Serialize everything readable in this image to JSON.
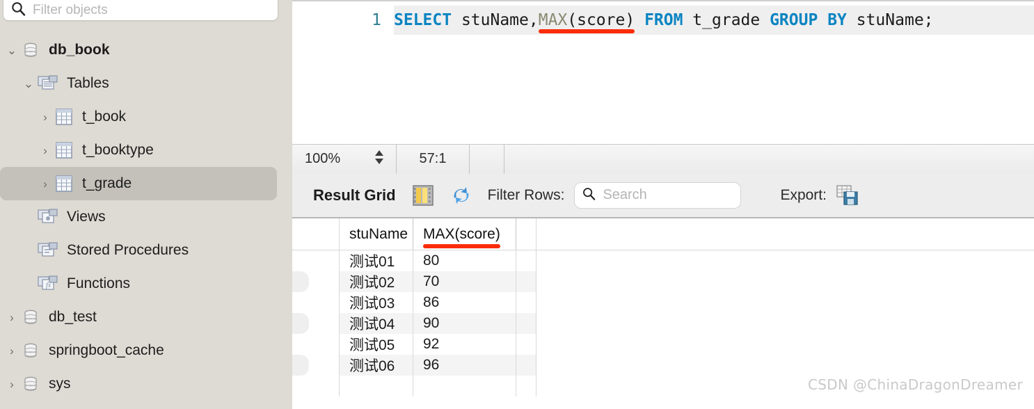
{
  "sidebar": {
    "filter": {
      "placeholder": "Filter objects",
      "value": "",
      "icon": "search-icon"
    },
    "items": [
      {
        "label": "db_book",
        "icon": "database-icon",
        "twisty": "⌄",
        "depth": 0,
        "bold": true,
        "selected": false
      },
      {
        "label": "Tables",
        "icon": "folder-tables-icon",
        "twisty": "⌄",
        "depth": 1,
        "bold": false,
        "selected": false
      },
      {
        "label": "t_book",
        "icon": "table-icon",
        "twisty": "›",
        "depth": 2,
        "bold": false,
        "selected": false
      },
      {
        "label": "t_booktype",
        "icon": "table-icon",
        "twisty": "›",
        "depth": 2,
        "bold": false,
        "selected": false
      },
      {
        "label": "t_grade",
        "icon": "table-icon",
        "twisty": "›",
        "depth": 2,
        "bold": false,
        "selected": true
      },
      {
        "label": "Views",
        "icon": "folder-views-icon",
        "twisty": "",
        "depth": 1,
        "bold": false,
        "selected": false
      },
      {
        "label": "Stored Procedures",
        "icon": "folder-procedures-icon",
        "twisty": "",
        "depth": 1,
        "bold": false,
        "selected": false
      },
      {
        "label": "Functions",
        "icon": "folder-functions-icon",
        "twisty": "",
        "depth": 1,
        "bold": false,
        "selected": false
      },
      {
        "label": "db_test",
        "icon": "database-icon",
        "twisty": "›",
        "depth": 0,
        "bold": false,
        "selected": false
      },
      {
        "label": "springboot_cache",
        "icon": "database-icon",
        "twisty": "›",
        "depth": 0,
        "bold": false,
        "selected": false
      },
      {
        "label": "sys",
        "icon": "database-icon",
        "twisty": "›",
        "depth": 0,
        "bold": false,
        "selected": false
      }
    ]
  },
  "editor": {
    "line_number": "1",
    "tokens": [
      {
        "text": "SELECT",
        "type": "keyword"
      },
      {
        "text": " stuName,",
        "type": "plain"
      },
      {
        "text": "MAX",
        "type": "function",
        "underlined": true
      },
      {
        "text": "(score)",
        "type": "plain",
        "underlined": true
      },
      {
        "text": " ",
        "type": "plain"
      },
      {
        "text": "FROM",
        "type": "keyword"
      },
      {
        "text": " t_grade ",
        "type": "plain"
      },
      {
        "text": "GROUP",
        "type": "keyword"
      },
      {
        "text": " ",
        "type": "plain"
      },
      {
        "text": "BY",
        "type": "keyword"
      },
      {
        "text": " stuName;",
        "type": "plain"
      }
    ],
    "full_text": "SELECT stuName,MAX(score) FROM t_grade GROUP BY stuName;"
  },
  "statusbar": {
    "zoom": "100%",
    "stepper_icon": "stepper-up-down-icon",
    "cursor_position": "57:1"
  },
  "result_toolbar": {
    "title": "Result Grid",
    "grid_view_icon": "grid-columns-icon",
    "refresh_icon": "refresh-icon",
    "filter_label": "Filter Rows:",
    "search": {
      "placeholder": "Search",
      "value": "",
      "icon": "search-icon"
    },
    "export_label": "Export:",
    "export_icon": "export-save-icon"
  },
  "result_grid": {
    "columns": [
      "stuName",
      "MAX(score)"
    ],
    "highlighted_column": "MAX(score)",
    "rows": [
      {
        "stuName": "测试01",
        "score": "80"
      },
      {
        "stuName": "测试02",
        "score": "70"
      },
      {
        "stuName": "测试03",
        "score": "86"
      },
      {
        "stuName": "测试04",
        "score": "90"
      },
      {
        "stuName": "测试05",
        "score": "92"
      },
      {
        "stuName": "测试06",
        "score": "96"
      }
    ]
  },
  "watermark": "CSDN @ChinaDragonDreamer",
  "colors": {
    "sidebar_bg": "#dedbd4",
    "selection_bg": "#c3c1ba",
    "keyword": "#0a84c1",
    "function": "#8a8a72",
    "annotation_red": "#fb2c0a",
    "line_number": "#2e7d91",
    "toolbar_bg": "#ededed"
  }
}
